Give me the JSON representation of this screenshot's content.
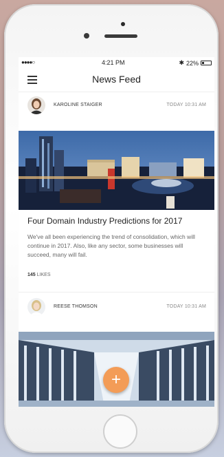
{
  "status_bar": {
    "signal": "●●●●○",
    "time": "4:21 PM",
    "bluetooth": "✱",
    "battery_percent": "22%",
    "battery_level": 0.22
  },
  "nav": {
    "title": "News Feed",
    "menu_icon": "hamburger-icon"
  },
  "posts": [
    {
      "author": "KAROLINE STAIGER",
      "time": "TODAY 10:31 AM",
      "image": "city-skyline-night",
      "title": "Four Domain Industry Predictions for 2017",
      "body": "We've all been experiencing the trend of consolidation, which will continue in 2017. Also, like any sector, some businesses will succeed, many will fail.",
      "likes_count": "145",
      "likes_label": "LIKES"
    },
    {
      "author": "REESE THOMSON",
      "time": "TODAY 10:31 AM",
      "image": "server-room"
    }
  ],
  "fab": {
    "icon": "plus-icon",
    "label": "+",
    "color": "#f39c57"
  }
}
